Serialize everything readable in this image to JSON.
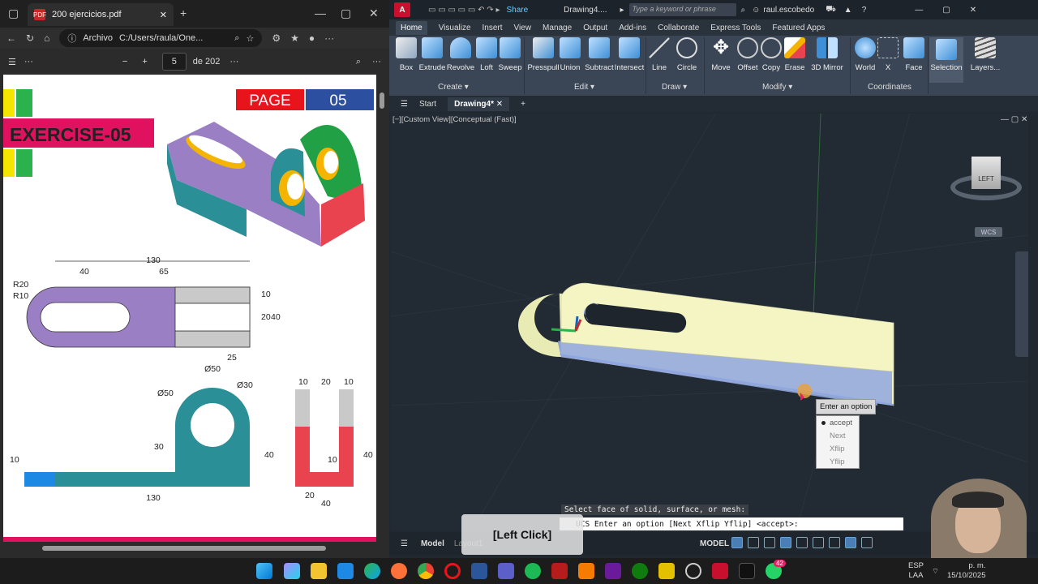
{
  "pdf_window": {
    "tab_title": "200 ejercicios.pdf",
    "address_scheme": "Archivo",
    "address_path": "C:/Users/raula/One...",
    "page_current": "5",
    "page_total_label": "de 202",
    "minus": "−",
    "plus": "+",
    "more": "···"
  },
  "pdf_page": {
    "page_label": "PAGE",
    "page_number": "05",
    "exercise_title": "EXERCISE-05",
    "dims_top": {
      "total": "130",
      "left": "40",
      "mid": "65",
      "r20": "R20",
      "r10": "R10",
      "h10": "10",
      "h20": "20",
      "h40": "40",
      "w25": "25",
      "d50": "Ø50"
    },
    "dims_front": {
      "d50": "Ø50",
      "d30": "Ø30",
      "h30": "30",
      "h40": "40",
      "h10": "10",
      "w130": "130"
    },
    "dims_side": {
      "t10a": "10",
      "t20": "20",
      "t10b": "10",
      "h40": "40",
      "h10": "10",
      "w20": "20",
      "w40": "40"
    }
  },
  "acad": {
    "logo": "A",
    "share": "Share",
    "doc_title": "Drawing4....",
    "search_placeholder": "Type a keyword or phrase",
    "user": "raul.escobedo",
    "ribbon_tabs": [
      "Home",
      "Visualize",
      "Insert",
      "View",
      "Manage",
      "Output",
      "Add-ins",
      "Collaborate",
      "Express Tools",
      "Featured Apps"
    ],
    "ribbon_buttons": {
      "create": [
        "Box",
        "Extrude",
        "Revolve",
        "Loft",
        "Sweep"
      ],
      "edit": [
        "Presspull",
        "Union",
        "Subtract",
        "Intersect"
      ],
      "draw": [
        "Line",
        "Circle"
      ],
      "modify": [
        "Move",
        "Offset",
        "Copy",
        "Erase",
        "3D Mirror"
      ],
      "coordinates": [
        "World",
        "X",
        "Face"
      ],
      "selection": "Selection",
      "layers": "Layers..."
    },
    "panel_labels": {
      "create": "Create ▾",
      "edit": "Edit ▾",
      "draw": "Draw ▾",
      "modify": "Modify ▾",
      "coordinates": "Coordinates"
    },
    "file_tabs": {
      "start": "Start",
      "active": "Drawing4*"
    },
    "viewport_label": "[−][Custom View][Conceptual (Fast)]",
    "viewcube_face": "LEFT",
    "wcs": "WCS",
    "tooltip": "Enter an option",
    "menu_items": [
      "accept",
      "Next",
      "Xflip",
      "Yflip"
    ],
    "prompt_history": "Select face of solid, surface, or mesh:",
    "command_line": "UCS Enter an option [Next Xflip Yflip] <accept>:",
    "status_model_tab": "Model",
    "status_layout_tab": "Layout1",
    "status_model": "MODEL",
    "click_overlay": "[Left Click]"
  },
  "taskbar": {
    "lang_1": "ESP",
    "lang_2": "LAA",
    "time": "p. m.",
    "date": "15/10/2025",
    "badge": "42"
  },
  "colors": {
    "purple": "#9b7fc4",
    "teal": "#2a8f96",
    "red": "#e8434f",
    "yellow": "#f4d03f",
    "lightyellow": "#f4f5c2",
    "blue": "#8fa6e0"
  }
}
